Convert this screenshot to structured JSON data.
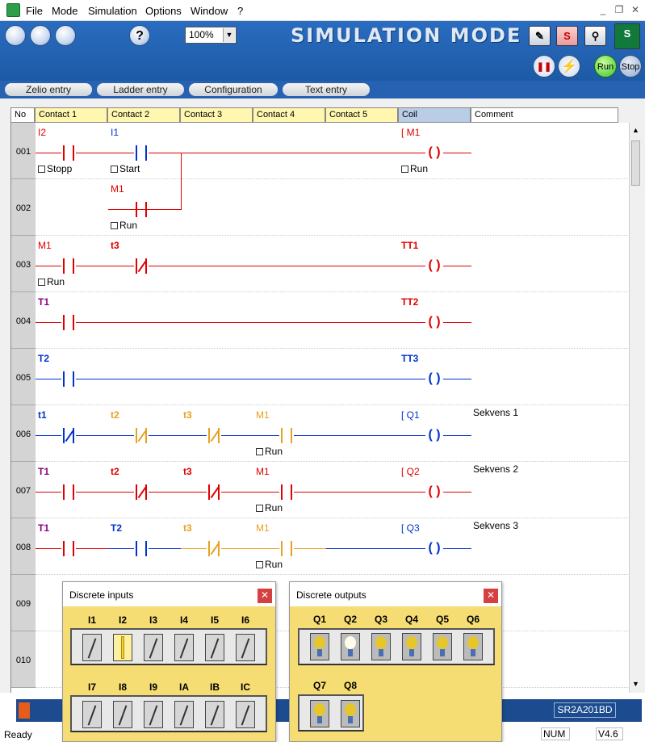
{
  "menu": {
    "file": "File",
    "mode": "Mode",
    "simulation": "Simulation",
    "options": "Options",
    "window": "Window",
    "help": "?"
  },
  "toolbar": {
    "zoom": "100%",
    "title": "SIMULATION MODE",
    "run": "Run",
    "stop": "Stop",
    "s": "S"
  },
  "tabs": [
    "Zelio entry",
    "Ladder entry",
    "Configuration",
    "Text entry"
  ],
  "columns": [
    "No",
    "Contact 1",
    "Contact 2",
    "Contact 3",
    "Contact 4",
    "Contact 5",
    "Coil",
    "Comment"
  ],
  "rungs": [
    {
      "no": "001",
      "c1": "I2",
      "c1sub": "Stopp",
      "c2": "I1",
      "c2sub": "Start",
      "coil": "M1",
      "coilsub": "Run"
    },
    {
      "no": "002",
      "c2": "M1",
      "c2sub": "Run"
    },
    {
      "no": "003",
      "c1": "M1",
      "c1sub": "Run",
      "c2": "t3",
      "coil": "TT1"
    },
    {
      "no": "004",
      "c1": "T1",
      "coil": "TT2"
    },
    {
      "no": "005",
      "c1": "T2",
      "coil": "TT3"
    },
    {
      "no": "006",
      "c1": "t1",
      "c2": "t2",
      "c3": "t3",
      "c4": "M1",
      "c4sub": "Run",
      "coil": "Q1",
      "comment": "Sekvens 1"
    },
    {
      "no": "007",
      "c1": "T1",
      "c2": "t2",
      "c3": "t3",
      "c4": "M1",
      "c4sub": "Run",
      "coil": "Q2",
      "comment": "Sekvens 2"
    },
    {
      "no": "008",
      "c1": "T1",
      "c2": "T2",
      "c3": "t3",
      "c4": "M1",
      "c4sub": "Run",
      "coil": "Q3",
      "comment": "Sekvens 3"
    },
    {
      "no": "009"
    },
    {
      "no": "010"
    }
  ],
  "inputs_panel": {
    "title": "Discrete inputs",
    "row1": [
      "I1",
      "I2",
      "I3",
      "I4",
      "I5",
      "I6"
    ],
    "row2": [
      "I7",
      "I8",
      "I9",
      "IA",
      "IB",
      "IC"
    ]
  },
  "outputs_panel": {
    "title": "Discrete outputs",
    "row1": [
      "Q1",
      "Q2",
      "Q3",
      "Q4",
      "Q5",
      "Q6"
    ],
    "row2": [
      "Q7",
      "Q8"
    ]
  },
  "status": {
    "ready": "Ready",
    "num": "NUM",
    "version": "V4.6",
    "model": "SR2A201BD"
  }
}
